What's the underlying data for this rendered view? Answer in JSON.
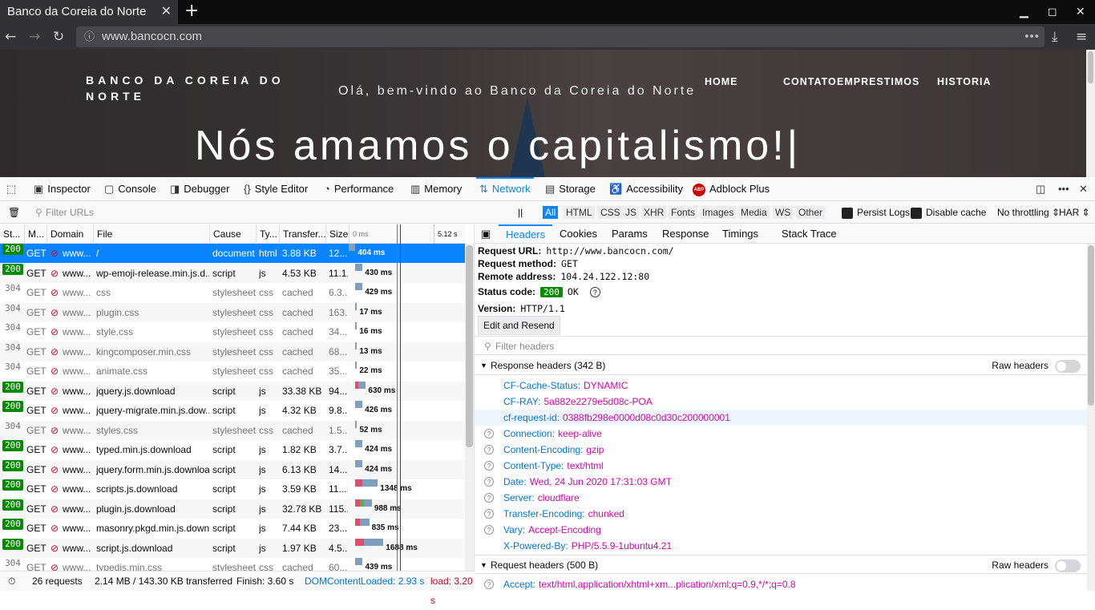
{
  "browser": {
    "tab_title": "Banco da Coreia do Norte",
    "url": "www.bancocn.com"
  },
  "page": {
    "logo": "BANCO DA COREIA DO NORTE",
    "welcome": "Olá, bem-vindo ao Banco da Coreia do Norte",
    "menu": [
      "HOME",
      "CONTATO",
      "EMPRESTIMOS",
      "HISTORIA"
    ],
    "hero": "Nós amamos o capitalismo!|"
  },
  "devtools": {
    "tabs": [
      "Inspector",
      "Console",
      "Debugger",
      "Style Editor",
      "Performance",
      "Memory",
      "Network",
      "Storage",
      "Accessibility",
      "Adblock Plus"
    ],
    "active_tab": "Network",
    "filter_placeholder": "Filter URLs",
    "pause": "||",
    "types": [
      "All",
      "HTML",
      "CSS",
      "JS",
      "XHR",
      "Fonts",
      "Images",
      "Media",
      "WS",
      "Other"
    ],
    "persist_logs": "Persist Logs",
    "disable_cache": "Disable cache",
    "throttling": "No throttling ⇕",
    "har": "HAR ⇕"
  },
  "network": {
    "columns": [
      "St...",
      "M...",
      "Domain",
      "File",
      "Cause",
      "Ty...",
      "Transfer...",
      "Size",
      "0 ms",
      "5.12 s"
    ],
    "rows": [
      {
        "status": "200",
        "method": "GET",
        "domain": "www....",
        "file": "/",
        "cause": "document",
        "type": "html",
        "transfer": "3.88 KB",
        "size": "12....",
        "time": "404 ms",
        "bar_start": 0,
        "bar_ms": 404
      },
      {
        "status": "200",
        "method": "GET",
        "domain": "www....",
        "file": "wp-emoji-release.min.js.d...",
        "cause": "script",
        "type": "js",
        "transfer": "4.53 KB",
        "size": "11.1...",
        "time": "430 ms",
        "bar_start": 404,
        "bar_ms": 430
      },
      {
        "status": "304",
        "method": "GET",
        "domain": "www....",
        "file": "css",
        "cause": "stylesheet",
        "type": "css",
        "transfer": "cached",
        "size": "6.3...",
        "time": "429 ms",
        "bar_start": 404,
        "bar_ms": 429
      },
      {
        "status": "304",
        "method": "GET",
        "domain": "www....",
        "file": "plugin.css",
        "cause": "stylesheet",
        "type": "css",
        "transfer": "cached",
        "size": "163...",
        "time": "17 ms",
        "bar_start": 404,
        "bar_ms": 17
      },
      {
        "status": "304",
        "method": "GET",
        "domain": "www....",
        "file": "style.css",
        "cause": "stylesheet",
        "type": "css",
        "transfer": "cached",
        "size": "34....",
        "time": "16 ms",
        "bar_start": 404,
        "bar_ms": 16
      },
      {
        "status": "304",
        "method": "GET",
        "domain": "www....",
        "file": "kingcomposer.min.css",
        "cause": "stylesheet",
        "type": "css",
        "transfer": "cached",
        "size": "68....",
        "time": "13 ms",
        "bar_start": 404,
        "bar_ms": 13
      },
      {
        "status": "304",
        "method": "GET",
        "domain": "www....",
        "file": "animate.css",
        "cause": "stylesheet",
        "type": "css",
        "transfer": "cached",
        "size": "35....",
        "time": "22 ms",
        "bar_start": 404,
        "bar_ms": 22
      },
      {
        "status": "200",
        "method": "GET",
        "domain": "www....",
        "file": "jquery.js.download",
        "cause": "script",
        "type": "js",
        "transfer": "33.38 KB",
        "size": "94....",
        "time": "630 ms",
        "bar_start": 404,
        "bar_ms": 630
      },
      {
        "status": "200",
        "method": "GET",
        "domain": "www....",
        "file": "jquery-migrate.min.js.dow...",
        "cause": "script",
        "type": "js",
        "transfer": "4.32 KB",
        "size": "9.8...",
        "time": "426 ms",
        "bar_start": 404,
        "bar_ms": 426
      },
      {
        "status": "304",
        "method": "GET",
        "domain": "www....",
        "file": "styles.css",
        "cause": "stylesheet",
        "type": "css",
        "transfer": "cached",
        "size": "1.5...",
        "time": "52 ms",
        "bar_start": 404,
        "bar_ms": 52
      },
      {
        "status": "200",
        "method": "GET",
        "domain": "www....",
        "file": "typed.min.js.download",
        "cause": "script",
        "type": "js",
        "transfer": "1.82 KB",
        "size": "3.7...",
        "time": "424 ms",
        "bar_start": 404,
        "bar_ms": 424
      },
      {
        "status": "200",
        "method": "GET",
        "domain": "www....",
        "file": "jquery.form.min.js.download",
        "cause": "script",
        "type": "js",
        "transfer": "6.13 KB",
        "size": "14....",
        "time": "424 ms",
        "bar_start": 404,
        "bar_ms": 424
      },
      {
        "status": "200",
        "method": "GET",
        "domain": "www....",
        "file": "scripts.js.download",
        "cause": "script",
        "type": "js",
        "transfer": "3.59 KB",
        "size": "11....",
        "time": "1348 ms",
        "bar_start": 404,
        "bar_ms": 1348
      },
      {
        "status": "200",
        "method": "GET",
        "domain": "www....",
        "file": "plugin.js.download",
        "cause": "script",
        "type": "js",
        "transfer": "32.78 KB",
        "size": "115...",
        "time": "988 ms",
        "bar_start": 404,
        "bar_ms": 988
      },
      {
        "status": "200",
        "method": "GET",
        "domain": "www....",
        "file": "masonry.pkgd.min.js.downl...",
        "cause": "script",
        "type": "js",
        "transfer": "7.44 KB",
        "size": "23....",
        "time": "835 ms",
        "bar_start": 404,
        "bar_ms": 835
      },
      {
        "status": "200",
        "method": "GET",
        "domain": "www....",
        "file": "script.js.download",
        "cause": "script",
        "type": "js",
        "transfer": "1.97 KB",
        "size": "4.5...",
        "time": "1688 ms",
        "bar_start": 404,
        "bar_ms": 1688
      },
      {
        "status": "304",
        "method": "GET",
        "domain": "www....",
        "file": "typedis.min.css",
        "cause": "stylesheet",
        "type": "css",
        "transfer": "cached",
        "size": "60....",
        "time": "439 ms",
        "bar_start": 404,
        "bar_ms": 439
      }
    ],
    "summary": {
      "requests": "26 requests",
      "transferred": "2.14 MB / 143.30 KB transferred",
      "finish": "Finish: 3.60 s",
      "domcontent": "DOMContentLoaded: 2.93 s",
      "load": "load: 3.20 s"
    }
  },
  "details": {
    "tabs": [
      "Headers",
      "Cookies",
      "Params",
      "Response",
      "Timings",
      "Stack Trace"
    ],
    "active_tab": "Headers",
    "request_url_label": "Request URL:",
    "request_url": "http://www.bancocn.com/",
    "method_label": "Request method:",
    "method": "GET",
    "remote_label": "Remote address:",
    "remote": "104.24.122.12:80",
    "status_label": "Status code:",
    "status_code": "200",
    "status_text": "OK",
    "version_label": "Version:",
    "version": "HTTP/1.1",
    "edit_resend": "Edit and Resend",
    "filter_headers": "Filter headers",
    "raw_headers": "Raw headers",
    "response_section": "Response headers (342 B)",
    "request_section": "Request headers (500 B)",
    "response_headers": [
      {
        "name": "CF-Cache-Status:",
        "value": "DYNAMIC",
        "help": false
      },
      {
        "name": "CF-RAY:",
        "value": "5a882e2279e5d08c-POA",
        "help": false
      },
      {
        "name": "cf-request-id:",
        "value": "0388fb298e0000d08c0d30c200000001",
        "help": false
      },
      {
        "name": "Connection:",
        "value": "keep-alive",
        "help": true
      },
      {
        "name": "Content-Encoding:",
        "value": "gzip",
        "help": true
      },
      {
        "name": "Content-Type:",
        "value": "text/html",
        "help": true
      },
      {
        "name": "Date:",
        "value": "Wed, 24 Jun 2020 17:31:03 GMT",
        "help": true
      },
      {
        "name": "Server:",
        "value": "cloudflare",
        "help": true
      },
      {
        "name": "Transfer-Encoding:",
        "value": "chunked",
        "help": true
      },
      {
        "name": "Vary:",
        "value": "Accept-Encoding",
        "help": true
      },
      {
        "name": "X-Powered-By:",
        "value": "PHP/5.5.9-1ubuntu4.21",
        "help": false
      }
    ],
    "request_headers": [
      {
        "name": "Accept:",
        "value": "text/html,application/xhtml+xm...plication/xml;q=0.9,*/*;q=0.8",
        "help": true
      }
    ]
  },
  "colors": {
    "accent": "#0a84ff",
    "status_ok": "#058b00",
    "header_name": "#0074e8",
    "header_value": "#dd00a9"
  }
}
